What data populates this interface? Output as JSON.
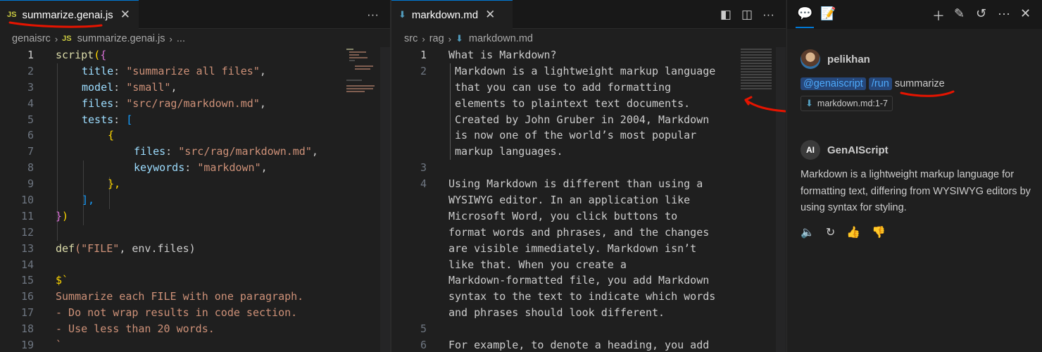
{
  "left_editor": {
    "tab": {
      "icon": "JS",
      "label": "summarize.genai.js",
      "close": "✕"
    },
    "more": "···",
    "breadcrumb": {
      "folder": "genaisrc",
      "file_icon": "JS",
      "file": "summarize.genai.js",
      "rest": "..."
    },
    "line_numbers": [
      "1",
      "2",
      "3",
      "4",
      "5",
      "6",
      "7",
      "8",
      "9",
      "10",
      "11",
      "12",
      "13",
      "14",
      "15",
      "16",
      "17",
      "18",
      "19"
    ],
    "code": {
      "l1a": "script",
      "l1b": "(",
      "l1c": "{",
      "l2k": "title",
      "l2s": "\"summarize all files\"",
      "l3k": "model",
      "l3s": "\"small\"",
      "l4k": "files",
      "l4s": "\"src/rag/markdown.md\"",
      "l5k": "tests",
      "l5b": "[",
      "l6": "{",
      "l7k": "files",
      "l7s": "\"src/rag/markdown.md\"",
      "l8k": "keywords",
      "l8s": "\"markdown\"",
      "l9": "},",
      "l10": "],",
      "l11a": "}",
      "l11b": ")",
      "l13a": "def",
      "l13b": "(\"FILE\"",
      "l13c": ", env.files)",
      "l15": "$`",
      "l16": "Summarize each FILE with one paragraph.",
      "l17": "- Do not wrap results in code section.",
      "l18": "- Use less than 20 words.",
      "l19": "`"
    }
  },
  "mid_editor": {
    "tab": {
      "label": "markdown.md",
      "close": "✕"
    },
    "breadcrumb": {
      "folder1": "src",
      "folder2": "rag",
      "file": "markdown.md"
    },
    "lines": [
      {
        "n": "1",
        "text": "What is Markdown?"
      },
      {
        "n": "2",
        "text": "Markdown is a lightweight markup language"
      },
      {
        "n": "",
        "text": "that you can use to add formatting"
      },
      {
        "n": "",
        "text": "elements to plaintext text documents."
      },
      {
        "n": "",
        "text": "Created by John Gruber in 2004, Markdown"
      },
      {
        "n": "",
        "text": "is now one of the world’s most popular"
      },
      {
        "n": "",
        "text": "markup languages."
      },
      {
        "n": "3",
        "text": ""
      },
      {
        "n": "4",
        "text": "Using Markdown is different than using a"
      },
      {
        "n": "",
        "text": "WYSIWYG editor. In an application like"
      },
      {
        "n": "",
        "text": "Microsoft Word, you click buttons to"
      },
      {
        "n": "",
        "text": "format words and phrases, and the changes"
      },
      {
        "n": "",
        "text": "are visible immediately. Markdown isn’t"
      },
      {
        "n": "",
        "text": "like that. When you create a"
      },
      {
        "n": "",
        "text": "Markdown-formatted file, you add Markdown"
      },
      {
        "n": "",
        "text": "syntax to the text to indicate which words"
      },
      {
        "n": "",
        "text": "and phrases should look different."
      },
      {
        "n": "5",
        "text": ""
      },
      {
        "n": "6",
        "text": "For example, to denote a heading, you add"
      }
    ]
  },
  "chat": {
    "user": {
      "name": "pelikhan",
      "participant": "@genaiscript",
      "command": "/run",
      "prompt": "summarize",
      "reference": "markdown.md:1-7"
    },
    "bot": {
      "name": "GenAIScript",
      "avatar": "AI",
      "response": "Markdown is a lightweight markup language for formatting text, differing from WYSIWYG editors by using syntax for styling."
    }
  },
  "colors": {
    "accent": "#0078d4",
    "annotation": "#e51400",
    "string": "#ce9178",
    "key": "#9cdcfe"
  }
}
